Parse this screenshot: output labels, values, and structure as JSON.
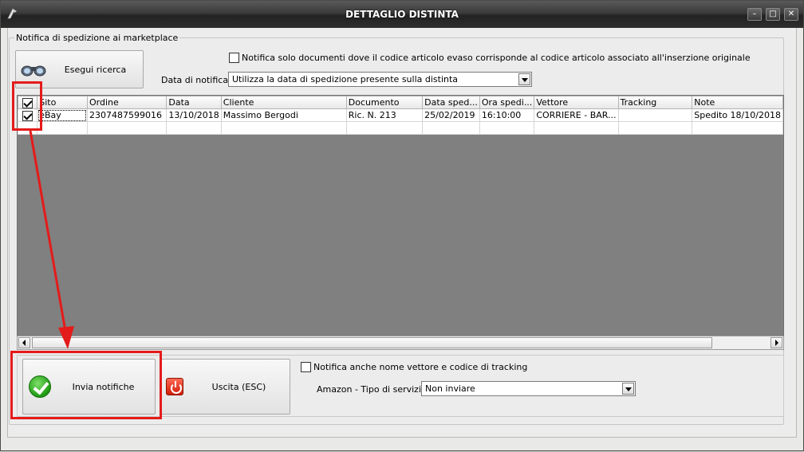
{
  "window": {
    "title": "DETTAGLIO DISTINTA"
  },
  "group": {
    "label": "Notifica di spedizione ai marketplace"
  },
  "search": {
    "button_label": "Esegui ricerca"
  },
  "options": {
    "match_code_label": "Notifica solo documenti dove il codice articolo evaso corrisponde al codice articolo associato all'inserzione originale",
    "match_code_checked": false,
    "notify_date_label": "Data di notifica :",
    "notify_date_value": "Utilizza la data di spedizione presente sulla distinta"
  },
  "grid": {
    "columns": [
      "Sito",
      "Ordine",
      "Data",
      "Cliente",
      "Documento",
      "Data sped...",
      "Ora spedi...",
      "Vettore",
      "Tracking",
      "Note"
    ],
    "rows": [
      {
        "checked": true,
        "cells": [
          "eBay",
          "2307487599016",
          "13/10/2018",
          "Massimo Bergodi",
          "Ric. N. 213",
          "25/02/2019",
          "16:10:00",
          "CORRIERE - BAR...",
          "",
          "Spedito 18/10/2018"
        ]
      }
    ]
  },
  "actions": {
    "send_label": "Invia notifiche",
    "exit_label": "Uscita (ESC)",
    "tracking_label": "Notifica anche nome vettore e codice di tracking",
    "tracking_checked": false,
    "amazon_label": "Amazon - Tipo di servizio :",
    "amazon_value": "Non inviare"
  },
  "colors": {
    "highlight": "#e41b1b"
  }
}
